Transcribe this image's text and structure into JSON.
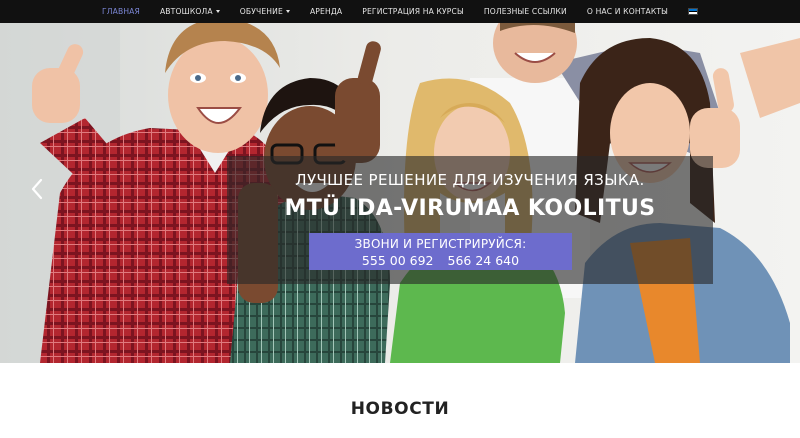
{
  "nav": {
    "items": [
      {
        "label": "ГЛАВНАЯ",
        "active": true,
        "dropdown": false
      },
      {
        "label": "АВТОШКОЛА",
        "active": false,
        "dropdown": true
      },
      {
        "label": "ОБУЧЕНИЕ",
        "active": false,
        "dropdown": true
      },
      {
        "label": "АРЕНДА",
        "active": false,
        "dropdown": false
      },
      {
        "label": "РЕГИСТРАЦИЯ НА КУРСЫ",
        "active": false,
        "dropdown": false
      },
      {
        "label": "ПОЛЕЗНЫЕ ССЫЛКИ",
        "active": false,
        "dropdown": false
      },
      {
        "label": "О НАС И КОНТАКТЫ",
        "active": false,
        "dropdown": false
      }
    ],
    "language_flag": {
      "icon": "estonian-flag-icon",
      "colors": [
        "#0072ce",
        "#000000",
        "#ffffff"
      ]
    },
    "active_color": "#7c87d6",
    "background": "#111111"
  },
  "hero": {
    "subtitle": "ЛУЧШЕЕ РЕШЕНИЕ ДЛЯ ИЗУЧЕНИЯ ЯЗЫКА.",
    "title": "MTÜ IDA-VIRUMAA KOOLITUS",
    "cta": {
      "text": "ЗВОНИ И РЕГИСТРИРУЙСЯ:",
      "phones": [
        "555 00 692",
        "566 24 640"
      ],
      "background": "#6d6ccd"
    },
    "prev_arrow_icon": "chevron-left-icon",
    "image": "photo of smiling students giving thumbs up"
  },
  "news": {
    "title": "НОВОСТИ"
  }
}
